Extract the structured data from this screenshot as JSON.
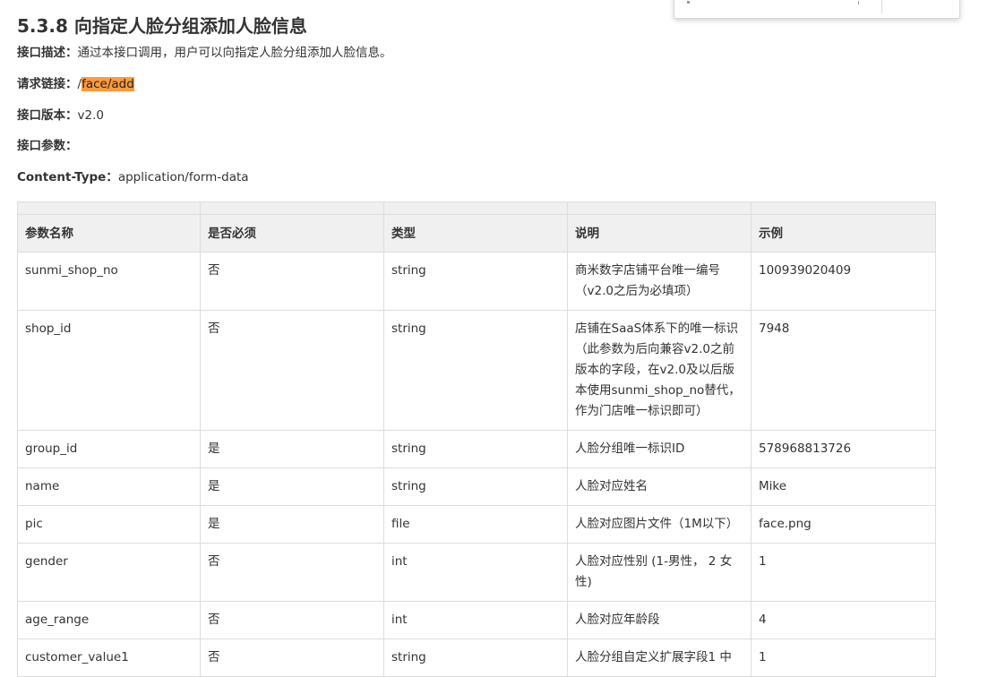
{
  "section": {
    "title": "5.3.8 向指定人脸分组添加人脸信息"
  },
  "meta": {
    "desc_label": "接口描述：",
    "desc_value": "通过本接口调用，用户可以向指定人脸分组添加人脸信息。",
    "url_label": "请求链接：",
    "url_slash": "/",
    "url_value": "face/add",
    "version_label": "接口版本：",
    "version_value": "v2.0",
    "params_label": "接口参数：",
    "ct_label": "Content-Type：",
    "ct_value": "application/form-data"
  },
  "colors": {
    "highlight": "#ff9a3c",
    "header_bg": "#f0f0f0",
    "border": "#dddddd"
  },
  "table": {
    "headers": [
      "参数名称",
      "是否必须",
      "类型",
      "说明",
      "示例"
    ],
    "rows": [
      [
        "sunmi_shop_no",
        "否",
        "string",
        "商米数字店铺平台唯一编号（v2.0之后为必填项）",
        "100939020409"
      ],
      [
        "shop_id",
        "否",
        "string",
        "店铺在SaaS体系下的唯一标识（此参数为后向兼容v2.0之前版本的字段，在v2.0及以后版本使用sunmi_shop_no替代，作为门店唯一标识即可）",
        "7948"
      ],
      [
        "group_id",
        "是",
        "string",
        "人脸分组唯一标识ID",
        "578968813726"
      ],
      [
        "name",
        "是",
        "string",
        "人脸对应姓名",
        "Mike"
      ],
      [
        "pic",
        "是",
        "file",
        "人脸对应图片文件（1M以下）",
        "face.png"
      ],
      [
        "gender",
        "否",
        "int",
        "人脸对应性别 (1-男性， 2 女性)",
        "1"
      ],
      [
        "age_range",
        "否",
        "int",
        "人脸对应年龄段",
        "4"
      ],
      [
        "customer_value1",
        "否",
        "string",
        "人脸分组自定义扩展字段1 中",
        "1"
      ]
    ]
  }
}
